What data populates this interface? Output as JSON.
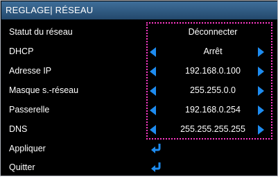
{
  "menu": {
    "title": "REGLAGE| RÉSEAU",
    "rows": [
      {
        "label": "Statut du réseau",
        "value": "Déconnecter"
      },
      {
        "label": "DHCP",
        "value": "Arrêt"
      },
      {
        "label": "Adresse IP",
        "value": "192.168.0.100"
      },
      {
        "label": "Masque s.-réseau",
        "value": "255.255.0.0"
      },
      {
        "label": "Passerelle",
        "value": "192.168.0.254"
      },
      {
        "label": "DNS",
        "value": "255.255.255.255"
      },
      {
        "label": "Appliquer"
      },
      {
        "label": "Quitter"
      }
    ]
  },
  "icons": {
    "left_arrow": "arrow-left-icon",
    "right_arrow": "arrow-right-icon",
    "enter": "enter-return-icon"
  },
  "colors": {
    "title_bar": "#2f5a82",
    "background": "#000000",
    "text": "#ffffff",
    "arrow": "#1e8cf0",
    "selection_border": "#ff39c8"
  }
}
